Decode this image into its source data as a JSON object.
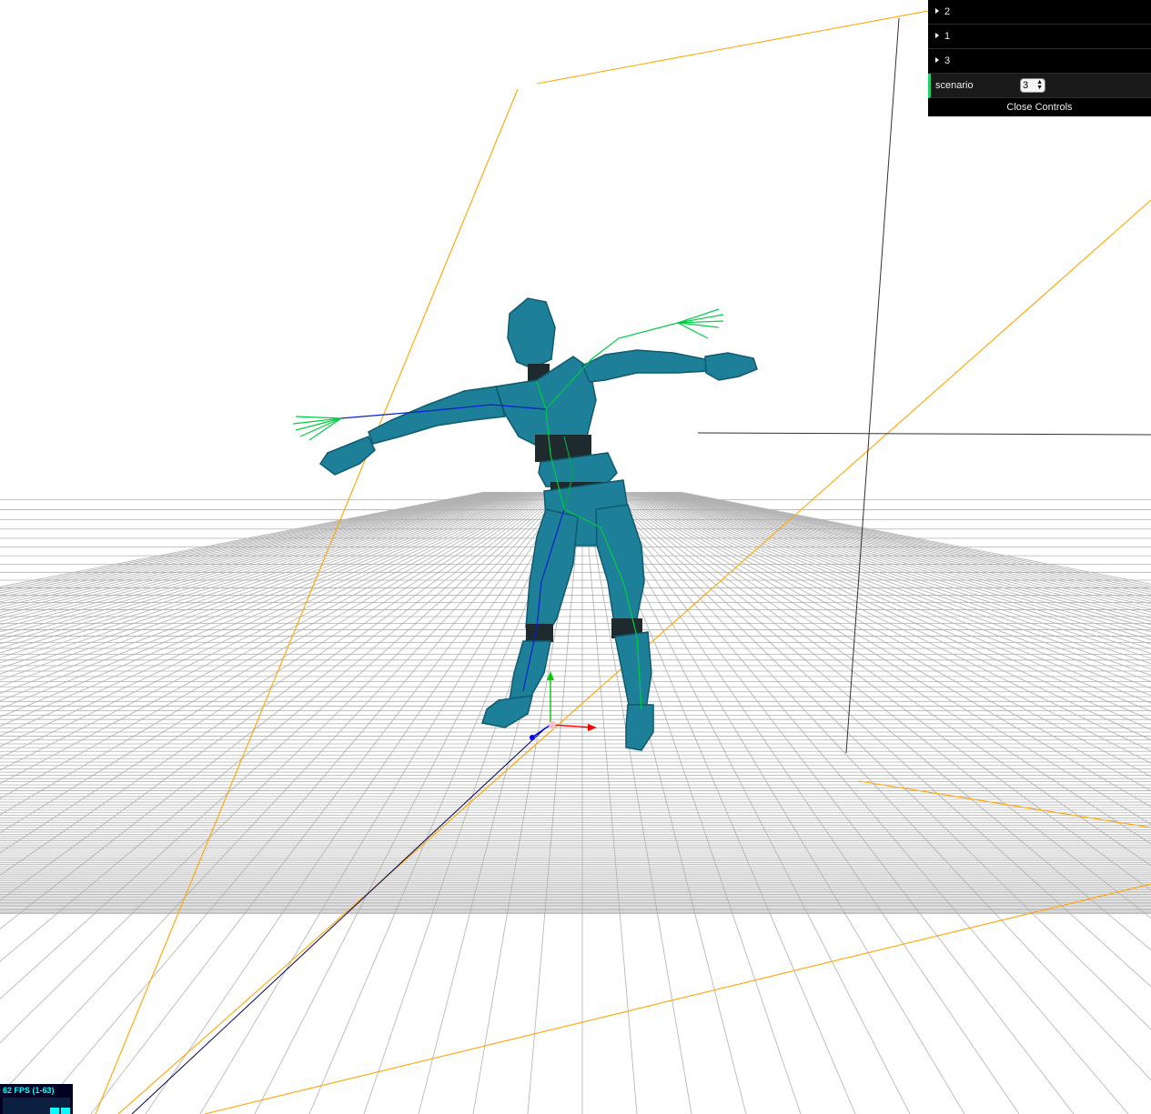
{
  "scene": {
    "background_color": "#ffffff",
    "grid_color": "#b0b0b0",
    "model_color": "#1a7f96",
    "camera_helper_color": "#ffa500",
    "skeleton_colors": [
      "#00cc44",
      "#0022cc"
    ],
    "axes_colors": {
      "x": "#ff0000",
      "y": "#00cc00",
      "z": "#0000ff"
    }
  },
  "gui": {
    "folders": [
      {
        "label": "2"
      },
      {
        "label": "1"
      },
      {
        "label": "3"
      }
    ],
    "controller": {
      "label": "scenario",
      "value": "3"
    },
    "close_label": "Close Controls"
  },
  "stats": {
    "text": "62 FPS (1-63)"
  }
}
